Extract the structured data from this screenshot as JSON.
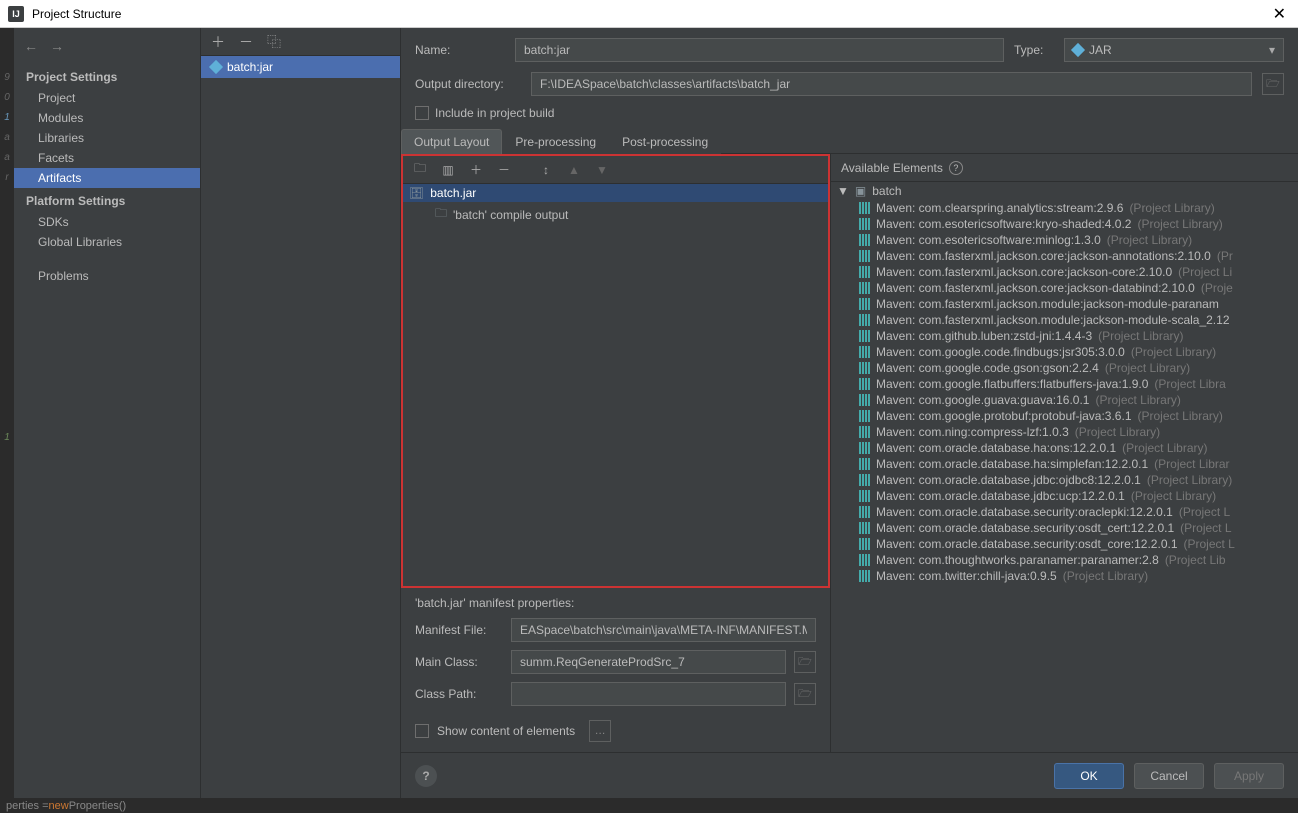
{
  "window": {
    "title": "Project Structure"
  },
  "sidebar": {
    "group1": "Project Settings",
    "items1": [
      "Project",
      "Modules",
      "Libraries",
      "Facets",
      "Artifacts"
    ],
    "group2": "Platform Settings",
    "items2": [
      "SDKs",
      "Global Libraries"
    ],
    "problems": "Problems"
  },
  "artifact_list": {
    "item": "batch:jar"
  },
  "form": {
    "name_label": "Name:",
    "name_value": "batch:jar",
    "type_label": "Type:",
    "type_value": "JAR",
    "outdir_label": "Output directory:",
    "outdir_value": "F:\\IDEASpace\\batch\\classes\\artifacts\\batch_jar",
    "include_label": "Include in project build"
  },
  "tabs": {
    "t1": "Output Layout",
    "t2": "Pre-processing",
    "t3": "Post-processing"
  },
  "tree": {
    "root": "batch.jar",
    "child": "'batch' compile output"
  },
  "manifest": {
    "title": "'batch.jar' manifest properties:",
    "file_label": "Manifest File:",
    "file_value": "EASpace\\batch\\src\\main\\java\\META-INF\\MANIFEST.MF",
    "main_label": "Main Class:",
    "main_value": "summ.ReqGenerateProdSrc_7",
    "cp_label": "Class Path:",
    "cp_value": "",
    "show_label": "Show content of elements"
  },
  "available": {
    "title": "Available Elements",
    "module": "batch",
    "libs": [
      {
        "n": "Maven: com.clearspring.analytics:stream:2.9.6",
        "s": "(Project Library)"
      },
      {
        "n": "Maven: com.esotericsoftware:kryo-shaded:4.0.2",
        "s": "(Project Library)"
      },
      {
        "n": "Maven: com.esotericsoftware:minlog:1.3.0",
        "s": "(Project Library)"
      },
      {
        "n": "Maven: com.fasterxml.jackson.core:jackson-annotations:2.10.0",
        "s": "(Pr"
      },
      {
        "n": "Maven: com.fasterxml.jackson.core:jackson-core:2.10.0",
        "s": "(Project Li"
      },
      {
        "n": "Maven: com.fasterxml.jackson.core:jackson-databind:2.10.0",
        "s": "(Proje"
      },
      {
        "n": "Maven: com.fasterxml.jackson.module:jackson-module-paranam",
        "s": ""
      },
      {
        "n": "Maven: com.fasterxml.jackson.module:jackson-module-scala_2.12",
        "s": ""
      },
      {
        "n": "Maven: com.github.luben:zstd-jni:1.4.4-3",
        "s": "(Project Library)"
      },
      {
        "n": "Maven: com.google.code.findbugs:jsr305:3.0.0",
        "s": "(Project Library)"
      },
      {
        "n": "Maven: com.google.code.gson:gson:2.2.4",
        "s": "(Project Library)"
      },
      {
        "n": "Maven: com.google.flatbuffers:flatbuffers-java:1.9.0",
        "s": "(Project Libra"
      },
      {
        "n": "Maven: com.google.guava:guava:16.0.1",
        "s": "(Project Library)"
      },
      {
        "n": "Maven: com.google.protobuf:protobuf-java:3.6.1",
        "s": "(Project Library)"
      },
      {
        "n": "Maven: com.ning:compress-lzf:1.0.3",
        "s": "(Project Library)"
      },
      {
        "n": "Maven: com.oracle.database.ha:ons:12.2.0.1",
        "s": "(Project Library)"
      },
      {
        "n": "Maven: com.oracle.database.ha:simplefan:12.2.0.1",
        "s": "(Project Librar"
      },
      {
        "n": "Maven: com.oracle.database.jdbc:ojdbc8:12.2.0.1",
        "s": "(Project Library)"
      },
      {
        "n": "Maven: com.oracle.database.jdbc:ucp:12.2.0.1",
        "s": "(Project Library)"
      },
      {
        "n": "Maven: com.oracle.database.security:oraclepki:12.2.0.1",
        "s": "(Project L"
      },
      {
        "n": "Maven: com.oracle.database.security:osdt_cert:12.2.0.1",
        "s": "(Project L"
      },
      {
        "n": "Maven: com.oracle.database.security:osdt_core:12.2.0.1",
        "s": "(Project L"
      },
      {
        "n": "Maven: com.thoughtworks.paranamer:paranamer:2.8",
        "s": "(Project Lib"
      },
      {
        "n": "Maven: com.twitter:chill-java:0.9.5",
        "s": "(Project Library)"
      }
    ]
  },
  "buttons": {
    "ok": "OK",
    "cancel": "Cancel",
    "apply": "Apply"
  },
  "code": {
    "pre": "perties = ",
    "kw": "new ",
    "post": "Properties()"
  }
}
